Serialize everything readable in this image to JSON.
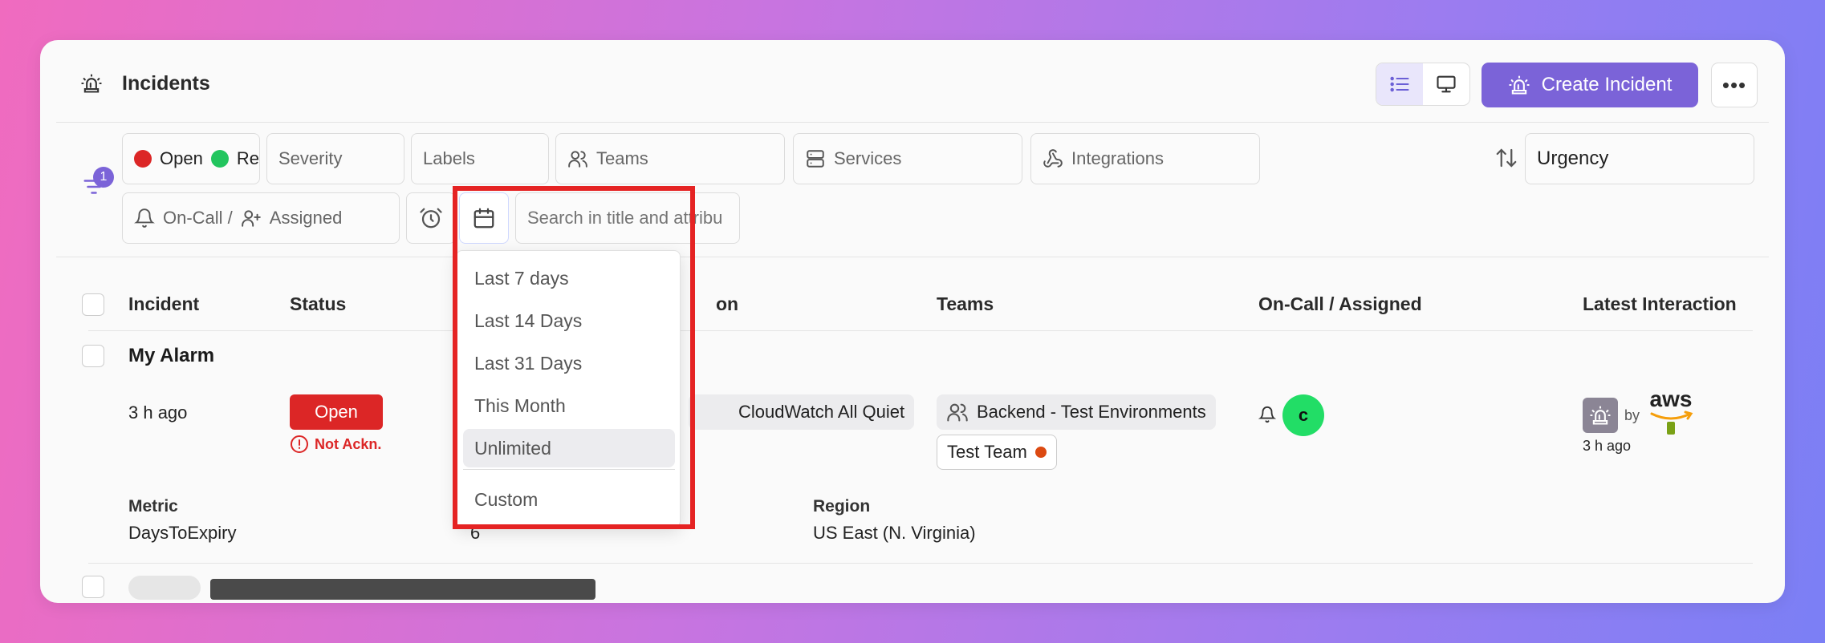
{
  "header": {
    "title": "Incidents",
    "create_label": "Create Incident",
    "more_label": "•••"
  },
  "filters": {
    "badge_count": "1",
    "status_open": "Open",
    "status_resolved": "Re",
    "severity": "Severity",
    "labels": "Labels",
    "teams": "Teams",
    "services": "Services",
    "integrations": "Integrations",
    "sort": "Urgency",
    "oncall": "On-Call /",
    "assigned": "Assigned",
    "search_placeholder": "Search in title and attribu"
  },
  "table": {
    "headers": {
      "incident": "Incident",
      "status": "Status",
      "integration_tail": "on",
      "teams": "Teams",
      "oncall": "On-Call / Assigned",
      "latest": "Latest Interaction"
    },
    "rows": [
      {
        "title": "My Alarm",
        "age": "3 h ago",
        "status": "Open",
        "ack": "Not Ackn.",
        "integration": "CloudWatch All Quiet",
        "team1": "Backend - Test Environments",
        "team2": "Test Team",
        "avatar": "c",
        "by": "by",
        "latest_time": "3 h ago",
        "aws": "aws",
        "attrs": {
          "metric_label": "Metric",
          "metric_value": "DaysToExpiry",
          "threshold_value": "6",
          "region_label": "Region",
          "region_value": "US East (N. Virginia)"
        }
      }
    ]
  },
  "date_dropdown": {
    "items": [
      "Last 7 days",
      "Last 14 Days",
      "Last 31 Days",
      "This Month",
      "Unlimited",
      "Custom"
    ],
    "selected": "Unlimited"
  },
  "colors": {
    "accent": "#7b63d8",
    "open_red": "#dc2626",
    "resolved_green": "#22c55e",
    "avatar_green": "#22dd66",
    "highlight_red": "#e52323"
  }
}
